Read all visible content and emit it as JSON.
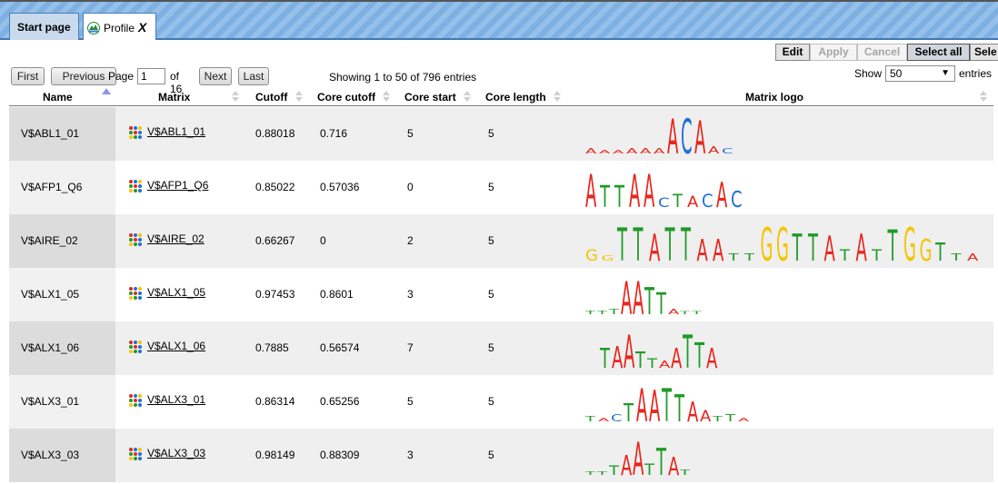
{
  "tabs": [
    {
      "label": "Start page"
    },
    {
      "label": "Profile",
      "close": "X"
    }
  ],
  "toolbar": {
    "edit": "Edit",
    "apply": "Apply",
    "cancel": "Cancel",
    "select_all": "Select all",
    "select_cut": "Sele"
  },
  "pager": {
    "first": "First",
    "previous": "Previous",
    "page_label": "Page",
    "page_value": "1",
    "of_label": "of 16",
    "next": "Next",
    "last": "Last"
  },
  "info": "Showing 1 to 50 of 796 entries",
  "show": {
    "label": "Show",
    "value": "50",
    "suffix": "entries"
  },
  "columns": [
    "Name",
    "Matrix",
    "Cutoff",
    "Core cutoff",
    "Core start",
    "Core length",
    "Matrix logo"
  ],
  "rows": [
    {
      "name": "V$ABL1_01",
      "matrix": "V$ABL1_01",
      "cutoff": "0.88018",
      "core_cutoff": "0.716",
      "core_start": "5",
      "core_length": "5"
    },
    {
      "name": "V$AFP1_Q6",
      "matrix": "V$AFP1_Q6",
      "cutoff": "0.85022",
      "core_cutoff": "0.57036",
      "core_start": "0",
      "core_length": "5"
    },
    {
      "name": "V$AIRE_02",
      "matrix": "V$AIRE_02",
      "cutoff": "0.66267",
      "core_cutoff": "0",
      "core_start": "2",
      "core_length": "5"
    },
    {
      "name": "V$ALX1_05",
      "matrix": "V$ALX1_05",
      "cutoff": "0.97453",
      "core_cutoff": "0.8601",
      "core_start": "3",
      "core_length": "5"
    },
    {
      "name": "V$ALX1_06",
      "matrix": "V$ALX1_06",
      "cutoff": "0.7885",
      "core_cutoff": "0.56574",
      "core_start": "7",
      "core_length": "5"
    },
    {
      "name": "V$ALX3_01",
      "matrix": "V$ALX3_01",
      "cutoff": "0.86314",
      "core_cutoff": "0.65256",
      "core_start": "5",
      "core_length": "5"
    },
    {
      "name": "V$ALX3_03",
      "matrix": "V$ALX3_03",
      "cutoff": "0.98149",
      "core_cutoff": "0.88309",
      "core_start": "3",
      "core_length": "5"
    }
  ],
  "logos": [
    [
      "A",
      "A",
      "A",
      "A",
      "A",
      "A",
      "A",
      "C",
      "A",
      "A",
      "C"
    ],
    [
      "A",
      "T",
      "T",
      "A",
      "A",
      "C",
      "T",
      "A",
      "C",
      "A",
      "C"
    ],
    [
      "G",
      "G",
      "T",
      "T",
      "A",
      "T",
      "T",
      "A",
      "A",
      "T",
      "T",
      "G",
      "G",
      "T",
      "T",
      "A",
      "T",
      "A",
      "T",
      "T",
      "G",
      "G",
      "T",
      "T",
      "A"
    ],
    [
      "T",
      "T",
      "T",
      "A",
      "A",
      "T",
      "T",
      "A",
      "T",
      "T"
    ],
    [
      "T",
      "A",
      "A",
      "T",
      "T",
      "A",
      "A",
      "T",
      "T",
      "A"
    ],
    [
      "T",
      "A",
      "C",
      "T",
      "A",
      "A",
      "T",
      "T",
      "A",
      "A",
      "T",
      "T",
      "A"
    ],
    [
      "T",
      "T",
      "T",
      "A",
      "A",
      "T",
      "T",
      "A",
      "T"
    ]
  ],
  "colors": {
    "A": "#e8261d",
    "C": "#1f6fd6",
    "G": "#f5c400",
    "T": "#1f9a28",
    "accent": "#7fb0e2"
  }
}
